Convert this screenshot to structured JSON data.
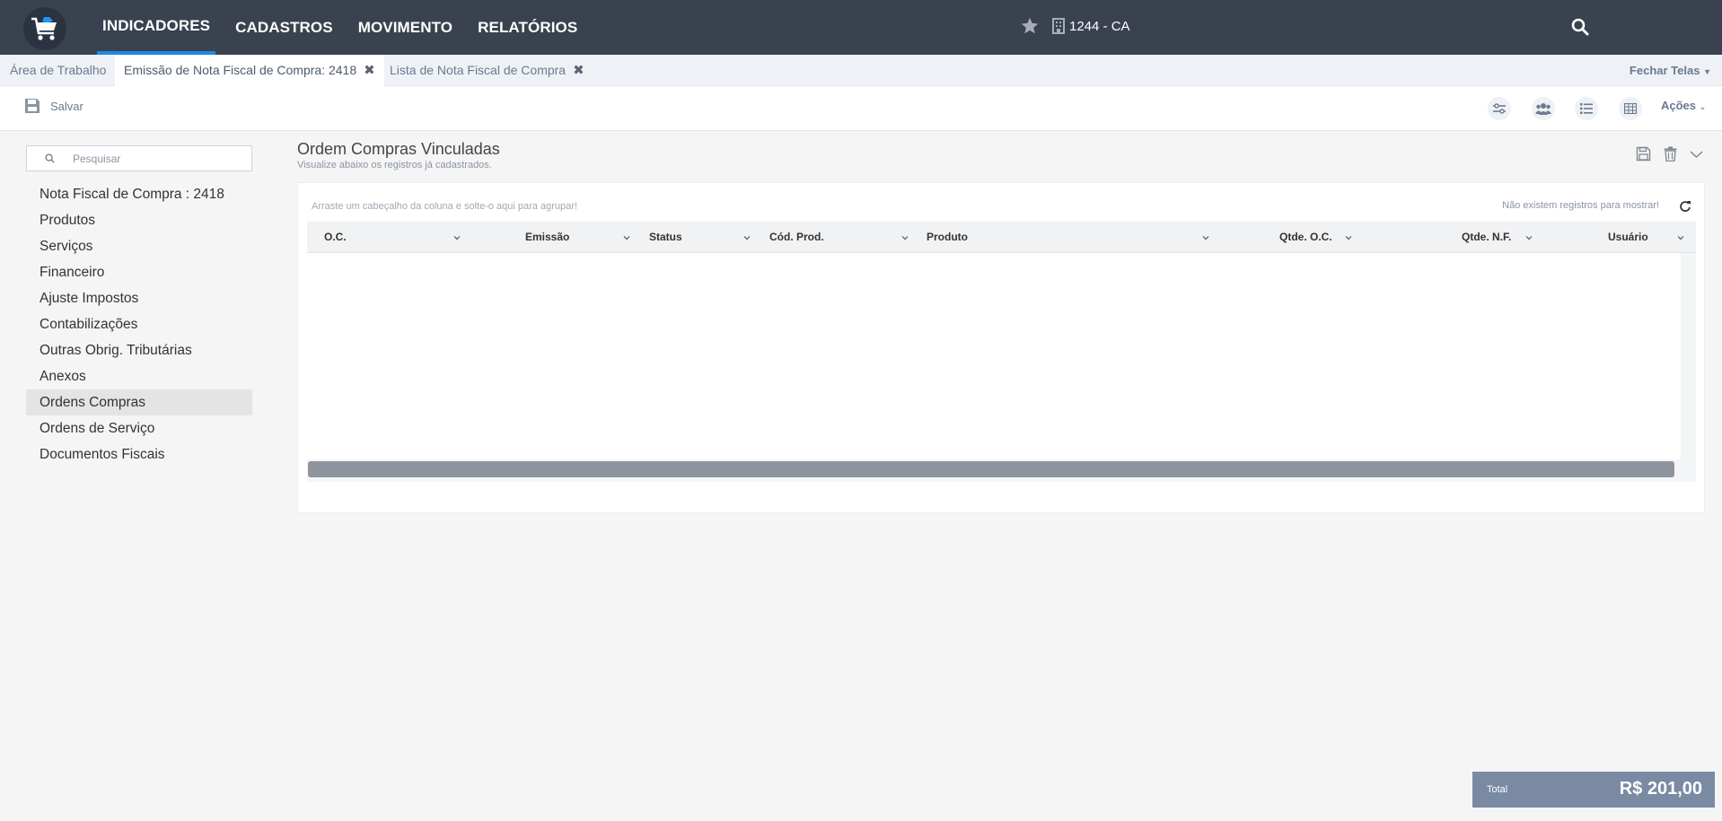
{
  "nav": {
    "items": [
      "INDICADORES",
      "CADASTROS",
      "MOVIMENTO",
      "RELATÓRIOS"
    ],
    "company": "1244 - CA"
  },
  "tabs": {
    "items": [
      {
        "label": "Área de Trabalho"
      },
      {
        "label": "Emissão de Nota Fiscal de Compra: 2418"
      },
      {
        "label": "Lista de Nota Fiscal de Compra"
      }
    ],
    "close_all": "Fechar Telas"
  },
  "toolbar": {
    "save_label": "Salvar",
    "actions_label": "Ações"
  },
  "sidebar": {
    "search_placeholder": "Pesquisar",
    "items": [
      "Nota Fiscal de Compra : 2418",
      "Produtos",
      "Serviços",
      "Financeiro",
      "Ajuste Impostos",
      "Contabilizações",
      "Outras Obrig. Tributárias",
      "Anexos",
      "Ordens Compras",
      "Ordens de Serviço",
      "Documentos Fiscais"
    ],
    "active": "Ordens Compras"
  },
  "panel": {
    "title": "Ordem Compras Vinculadas",
    "subtitle": "Visualize abaixo os registros já cadastrados.",
    "group_hint": "Arraste um cabeçalho da coluna e solte-o aqui para agrupar!",
    "empty_message": "Não existem registros para mostrar!",
    "columns": [
      "O.C.",
      "Emissão",
      "Status",
      "Cód. Prod.",
      "Produto",
      "Qtde. O.C.",
      "Qtde. N.F.",
      "Usuário"
    ]
  },
  "total": {
    "label": "Total",
    "value": "R$ 201,00"
  },
  "colors": {
    "topbar": "#3a4250",
    "accent": "#1e88e5",
    "total_bg": "#7a8aa3"
  }
}
